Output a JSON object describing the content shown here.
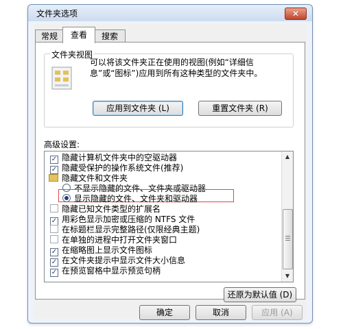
{
  "window": {
    "title": "文件夹选项",
    "close_glyph": "✕"
  },
  "tabs": [
    {
      "label": "常规"
    },
    {
      "label": "查看"
    },
    {
      "label": "搜索"
    }
  ],
  "folder_views": {
    "heading": "文件夹视图",
    "description": "可以将该文件夹正在使用的视图(例如“详细信息”或“图标”)应用到所有这种类型的文件夹中。",
    "apply_button": "应用到文件夹 (L)",
    "reset_button": "重置文件夹 (R)"
  },
  "advanced": {
    "label": "高级设置:",
    "items": [
      {
        "type": "checkbox",
        "checked": true,
        "label": "隐藏计算机文件夹中的空驱动器"
      },
      {
        "type": "checkbox",
        "checked": true,
        "label": "隐藏受保护的操作系统文件(推荐)"
      },
      {
        "type": "folder",
        "label": "隐藏文件和文件夹"
      },
      {
        "type": "radio",
        "checked": false,
        "label": "不显示隐藏的文件、文件夹或驱动器"
      },
      {
        "type": "radio",
        "checked": true,
        "label": "显示隐藏的文件、文件夹和驱动器"
      },
      {
        "type": "checkbox",
        "checked": false,
        "label": "隐藏已知文件类型的扩展名"
      },
      {
        "type": "checkbox",
        "checked": true,
        "label": "用彩色显示加密或压缩的 NTFS 文件"
      },
      {
        "type": "checkbox",
        "checked": false,
        "label": "在标题栏显示完整路径(仅限经典主题)"
      },
      {
        "type": "checkbox",
        "checked": false,
        "label": "在单独的进程中打开文件夹窗口"
      },
      {
        "type": "checkbox",
        "checked": true,
        "label": "在缩略图上显示文件图标"
      },
      {
        "type": "checkbox",
        "checked": true,
        "label": "在文件夹提示中显示文件大小信息"
      },
      {
        "type": "checkbox",
        "checked": true,
        "label": "在预览窗格中显示预览句柄"
      }
    ],
    "restore_button": "还原为默认值 (D)"
  },
  "footer": {
    "ok": "确定",
    "cancel": "取消",
    "apply": "应用 (A)"
  },
  "icons": {
    "folder_view": "folder-view-icon",
    "scroll_up": "▲",
    "scroll_down": "▼"
  }
}
